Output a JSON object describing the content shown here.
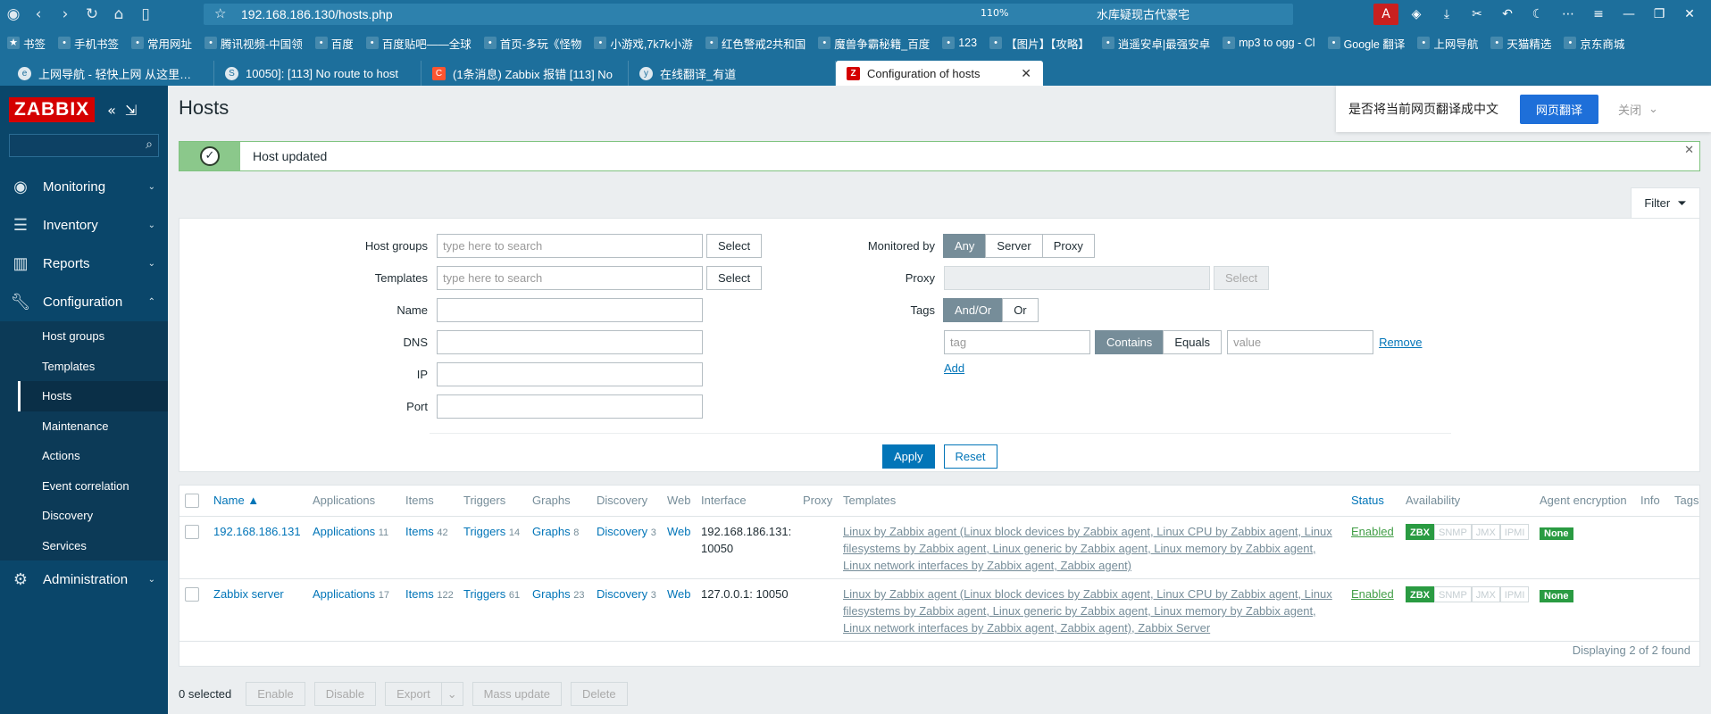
{
  "browser": {
    "url": "192.168.186.130/hosts.php",
    "zoom": "110%",
    "search_text": "水库疑现古代豪宅",
    "bookmarks": [
      "书签",
      "手机书签",
      "常用网址",
      "腾讯视频-中国领",
      "百度",
      "百度贴吧——全球",
      "首页-多玩《怪物",
      "小游戏,7k7k小游",
      "红色警戒2共和国",
      "魔兽争霸秘籍_百度",
      "123",
      "【图片】【攻略】",
      "逍遥安卓|最强安卓",
      "mp3 to ogg - Cl",
      "Google 翻译",
      "上网导航",
      "天猫精选",
      "京东商城"
    ],
    "tabs": [
      {
        "title": "上网导航 - 轻快上网 从这里开始"
      },
      {
        "title": "10050]: [113] No route to host"
      },
      {
        "title": "(1条消息) Zabbix 报错 [113] No"
      },
      {
        "title": "在线翻译_有道"
      },
      {
        "title": "Configuration of hosts"
      }
    ]
  },
  "sidebar": {
    "logo": "ZABBIX",
    "menu": [
      {
        "label": "Monitoring"
      },
      {
        "label": "Inventory"
      },
      {
        "label": "Reports"
      },
      {
        "label": "Configuration"
      },
      {
        "label": "Administration"
      }
    ],
    "sub": [
      "Host groups",
      "Templates",
      "Hosts",
      "Maintenance",
      "Actions",
      "Event correlation",
      "Discovery",
      "Services"
    ]
  },
  "page": {
    "title": "Hosts",
    "message": "Host updated",
    "translate_prompt": "是否将当前网页翻译成中文",
    "translate_button": "网页翻译",
    "translate_close": "关闭"
  },
  "filter": {
    "tab_label": "Filter",
    "host_groups_label": "Host groups",
    "templates_label": "Templates",
    "name_label": "Name",
    "dns_label": "DNS",
    "ip_label": "IP",
    "port_label": "Port",
    "search_placeholder": "type here to search",
    "select_label": "Select",
    "monitored_by_label": "Monitored by",
    "monitored_by": [
      "Any",
      "Server",
      "Proxy"
    ],
    "proxy_label": "Proxy",
    "tags_label": "Tags",
    "tags_mode": [
      "And/Or",
      "Or"
    ],
    "tag_placeholder": "tag",
    "tag_ops": [
      "Contains",
      "Equals"
    ],
    "value_placeholder": "value",
    "remove_label": "Remove",
    "add_label": "Add",
    "apply_label": "Apply",
    "reset_label": "Reset"
  },
  "table": {
    "headers": [
      "Name ▲",
      "Applications",
      "Items",
      "Triggers",
      "Graphs",
      "Discovery",
      "Web",
      "Interface",
      "Proxy",
      "Templates",
      "Status",
      "Availability",
      "Agent encryption",
      "Info",
      "Tags"
    ],
    "rows": [
      {
        "name": "192.168.186.131",
        "applications": "Applications",
        "applications_n": "11",
        "items": "Items",
        "items_n": "42",
        "triggers": "Triggers",
        "triggers_n": "14",
        "graphs": "Graphs",
        "graphs_n": "8",
        "discovery": "Discovery",
        "discovery_n": "3",
        "web": "Web",
        "interface_1": "192.168.186.131:",
        "interface_2": "10050",
        "tmpl_1": "Linux by Zabbix agent (Linux block devices by Zabbix agent, Linux CPU by Zabbix agent, Linux",
        "tmpl_2": "filesystems by Zabbix agent, Linux generic by Zabbix agent, Linux memory by Zabbix agent,",
        "tmpl_3": "Linux network interfaces by Zabbix agent, Zabbix agent)",
        "status": "Enabled",
        "encryption": "None"
      },
      {
        "name": "Zabbix server",
        "applications": "Applications",
        "applications_n": "17",
        "items": "Items",
        "items_n": "122",
        "triggers": "Triggers",
        "triggers_n": "61",
        "graphs": "Graphs",
        "graphs_n": "23",
        "discovery": "Discovery",
        "discovery_n": "3",
        "web": "Web",
        "interface_1": "127.0.0.1: 10050",
        "interface_2": "",
        "tmpl_1": "Linux by Zabbix agent (Linux block devices by Zabbix agent, Linux CPU by Zabbix agent, Linux",
        "tmpl_2": "filesystems by Zabbix agent, Linux generic by Zabbix agent, Linux memory by Zabbix agent,",
        "tmpl_3": "Linux network interfaces by Zabbix agent, Zabbix agent), Zabbix Server",
        "status": "Enabled",
        "encryption": "None"
      }
    ],
    "availability": [
      "ZBX",
      "SNMP",
      "JMX",
      "IPMI"
    ],
    "footer": "Displaying 2 of 2 found"
  },
  "bottom": {
    "selected": "0 selected",
    "buttons": [
      "Enable",
      "Disable",
      "Export",
      "Mass update",
      "Delete"
    ]
  }
}
